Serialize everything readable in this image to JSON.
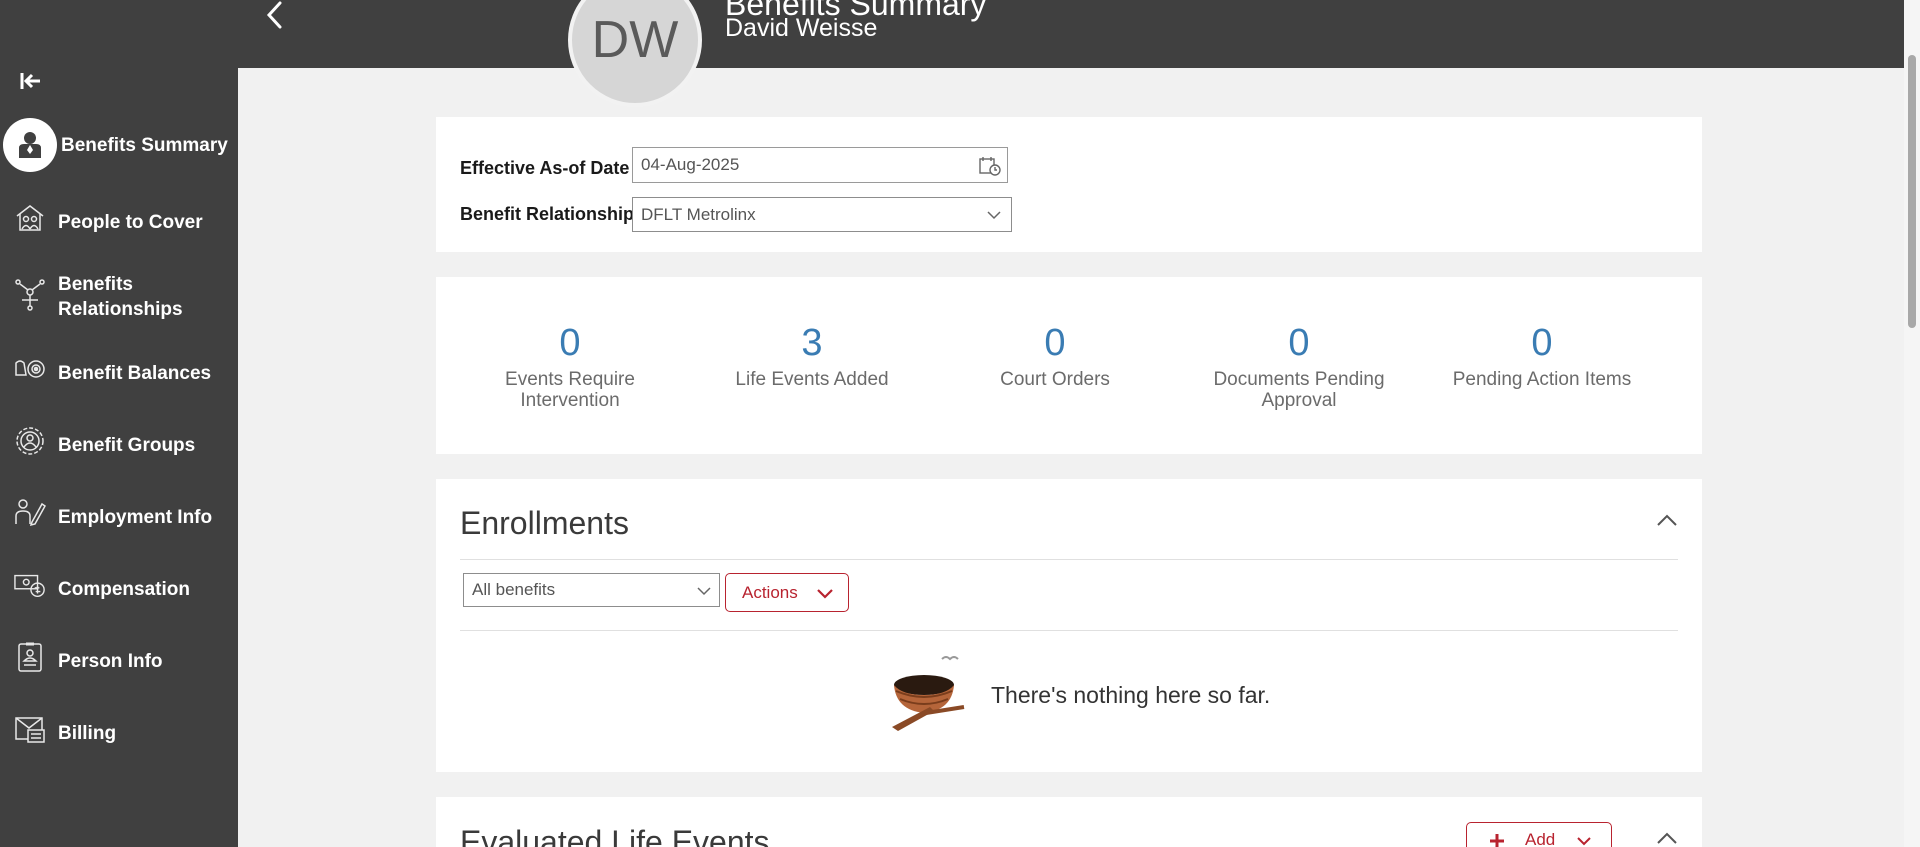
{
  "header": {
    "avatar_initials": "DW",
    "title": "Benefits Summary",
    "subtitle": "David Weisse"
  },
  "sidebar": {
    "items": [
      {
        "label": "Benefits Summary",
        "icon": "person-icon",
        "active": true
      },
      {
        "label": "People to Cover",
        "icon": "house-people-icon"
      },
      {
        "label": "Benefits Relationships",
        "icon": "hierarchy-icon"
      },
      {
        "label": "Benefit Balances",
        "icon": "balances-icon"
      },
      {
        "label": "Benefit Groups",
        "icon": "groups-gear-icon"
      },
      {
        "label": "Employment Info",
        "icon": "employment-icon"
      },
      {
        "label": "Compensation",
        "icon": "compensation-icon"
      },
      {
        "label": "Person Info",
        "icon": "badge-icon"
      },
      {
        "label": "Billing",
        "icon": "billing-icon"
      }
    ]
  },
  "filters": {
    "effective_date_label": "Effective As-of Date",
    "effective_date_value": "04-Aug-2025",
    "relationship_label": "Benefit Relationship",
    "relationship_value": "DFLT Metrolinx"
  },
  "metrics": [
    {
      "value": "0",
      "label_line1": "Events Require",
      "label_line2": "Intervention"
    },
    {
      "value": "3",
      "label_line1": "Life Events Added",
      "label_line2": ""
    },
    {
      "value": "0",
      "label_line1": "Court Orders",
      "label_line2": ""
    },
    {
      "value": "0",
      "label_line1": "Documents Pending",
      "label_line2": "Approval"
    },
    {
      "value": "0",
      "label_line1": "Pending Action Items",
      "label_line2": ""
    }
  ],
  "enrollments": {
    "title": "Enrollments",
    "filter_value": "All benefits",
    "actions_label": "Actions",
    "empty_message": "There's nothing here so far."
  },
  "life_events": {
    "title": "Evaluated Life Events",
    "add_label": "Add"
  },
  "colors": {
    "dark_gray": "#404040",
    "accent_red": "#b8232f",
    "metric_blue": "#3a7cb3"
  }
}
